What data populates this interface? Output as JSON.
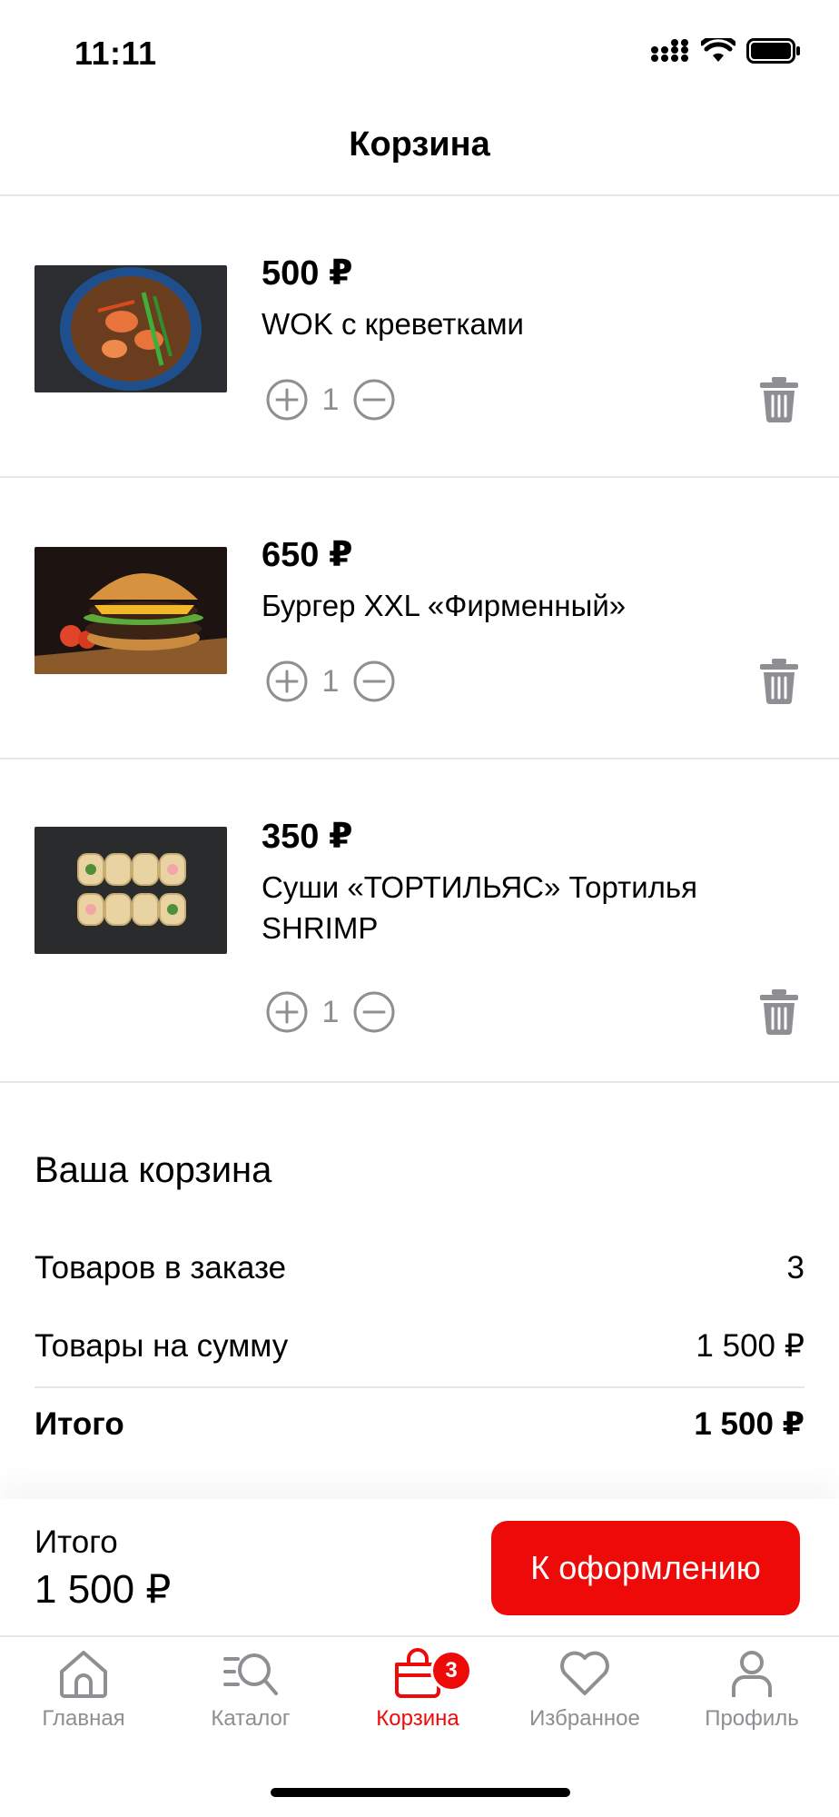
{
  "status_bar": {
    "time": "11:11"
  },
  "header": {
    "title": "Корзина"
  },
  "cart": {
    "items": [
      {
        "price": "500 ₽",
        "name": "WOK с креветками",
        "quantity": "1"
      },
      {
        "price": "650 ₽",
        "name": "Бургер XXL «Фирменный»",
        "quantity": "1"
      },
      {
        "price": "350 ₽",
        "name": "Суши «ТОРТИЛЬЯС» Тортилья SHRIMP",
        "quantity": "1"
      }
    ]
  },
  "summary": {
    "title": "Ваша корзина",
    "items_label": "Товаров в заказе",
    "items_value": "3",
    "sum_label": "Товары на сумму",
    "sum_value": "1 500 ₽",
    "total_label": "Итого",
    "total_value": "1 500 ₽"
  },
  "checkout": {
    "label": "Итого",
    "total": "1 500 ₽",
    "button": "К оформлению"
  },
  "tabs": [
    {
      "label": "Главная",
      "icon": "home-icon"
    },
    {
      "label": "Каталог",
      "icon": "catalog-search-icon"
    },
    {
      "label": "Корзина",
      "icon": "bag-icon",
      "badge": "3",
      "active": true
    },
    {
      "label": "Избранное",
      "icon": "heart-icon"
    },
    {
      "label": "Профиль",
      "icon": "person-icon"
    }
  ],
  "colors": {
    "accent": "#ef0a0a",
    "muted": "#8e8e93",
    "divider": "#e6e6e8"
  }
}
